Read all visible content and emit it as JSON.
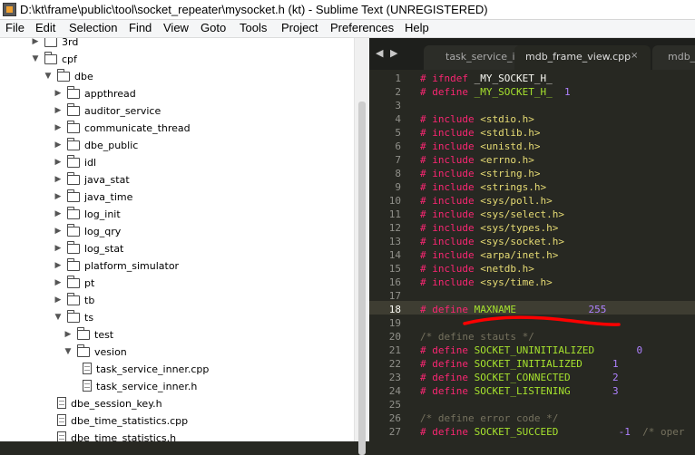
{
  "window": {
    "title": "D:\\kt\\frame\\public\\tool\\socket_repeater\\mysocket.h (kt) - Sublime Text (UNREGISTERED)"
  },
  "menu": [
    "File",
    "Edit",
    "Selection",
    "Find",
    "View",
    "Goto",
    "Tools",
    "Project",
    "Preferences",
    "Help"
  ],
  "sidebar": {
    "items": [
      {
        "label": "3rd",
        "type": "folder",
        "depth": 2,
        "expanded": false
      },
      {
        "label": "cpf",
        "type": "folder",
        "depth": 2,
        "expanded": true
      },
      {
        "label": "dbe",
        "type": "folder",
        "depth": 3,
        "expanded": true
      },
      {
        "label": "appthread",
        "type": "folder",
        "depth": 4,
        "expanded": false
      },
      {
        "label": "auditor_service",
        "type": "folder",
        "depth": 4,
        "expanded": false
      },
      {
        "label": "communicate_thread",
        "type": "folder",
        "depth": 4,
        "expanded": false
      },
      {
        "label": "dbe_public",
        "type": "folder",
        "depth": 4,
        "expanded": false
      },
      {
        "label": "idl",
        "type": "folder",
        "depth": 4,
        "expanded": false
      },
      {
        "label": "java_stat",
        "type": "folder",
        "depth": 4,
        "expanded": false
      },
      {
        "label": "java_time",
        "type": "folder",
        "depth": 4,
        "expanded": false
      },
      {
        "label": "log_init",
        "type": "folder",
        "depth": 4,
        "expanded": false
      },
      {
        "label": "log_qry",
        "type": "folder",
        "depth": 4,
        "expanded": false
      },
      {
        "label": "log_stat",
        "type": "folder",
        "depth": 4,
        "expanded": false
      },
      {
        "label": "platform_simulator",
        "type": "folder",
        "depth": 4,
        "expanded": false
      },
      {
        "label": "pt",
        "type": "folder",
        "depth": 4,
        "expanded": false
      },
      {
        "label": "tb",
        "type": "folder",
        "depth": 4,
        "expanded": false
      },
      {
        "label": "ts",
        "type": "folder",
        "depth": 4,
        "expanded": true
      },
      {
        "label": "test",
        "type": "folder",
        "depth": 5,
        "expanded": false
      },
      {
        "label": "vesion",
        "type": "folder",
        "depth": 5,
        "expanded": true
      },
      {
        "label": "task_service_inner.cpp",
        "type": "file",
        "depth": 6
      },
      {
        "label": "task_service_inner.h",
        "type": "file",
        "depth": 6
      },
      {
        "label": "dbe_session_key.h",
        "type": "file",
        "depth": 5
      },
      {
        "label": "dbe_time_statistics.cpp",
        "type": "file",
        "depth": 5
      },
      {
        "label": "dbe_time_statistics.h",
        "type": "file",
        "depth": 5
      }
    ]
  },
  "tabs": [
    {
      "label": "task_service_in",
      "active": false,
      "closable": false
    },
    {
      "label": "mdb_frame_view.cpp",
      "active": true,
      "closable": true,
      "close": "×"
    },
    {
      "label": "mdb_",
      "active": false,
      "closable": false
    }
  ],
  "tab_nav": {
    "left": "◀",
    "right": "▶"
  },
  "editor": {
    "current_line": 18,
    "lines": [
      {
        "n": "1",
        "t": [
          [
            "hash",
            "# "
          ],
          [
            "kw",
            "ifndef"
          ],
          [
            "ws",
            " _MY_SOCKET_H_"
          ]
        ]
      },
      {
        "n": "2",
        "t": [
          [
            "hash",
            "# "
          ],
          [
            "kw",
            "define"
          ],
          [
            "ws",
            " "
          ],
          [
            "mac",
            "_MY_SOCKET_H_"
          ],
          [
            "ws",
            "  "
          ],
          [
            "num",
            "1"
          ]
        ]
      },
      {
        "n": "3",
        "t": []
      },
      {
        "n": "4",
        "t": [
          [
            "hash",
            "# "
          ],
          [
            "kw",
            "include"
          ],
          [
            "ws",
            " "
          ],
          [
            "hdr",
            "<stdio.h>"
          ]
        ]
      },
      {
        "n": "5",
        "t": [
          [
            "hash",
            "# "
          ],
          [
            "kw",
            "include"
          ],
          [
            "ws",
            " "
          ],
          [
            "hdr",
            "<stdlib.h>"
          ]
        ]
      },
      {
        "n": "6",
        "t": [
          [
            "hash",
            "# "
          ],
          [
            "kw",
            "include"
          ],
          [
            "ws",
            " "
          ],
          [
            "hdr",
            "<unistd.h>"
          ]
        ]
      },
      {
        "n": "7",
        "t": [
          [
            "hash",
            "# "
          ],
          [
            "kw",
            "include"
          ],
          [
            "ws",
            " "
          ],
          [
            "hdr",
            "<errno.h>"
          ]
        ]
      },
      {
        "n": "8",
        "t": [
          [
            "hash",
            "# "
          ],
          [
            "kw",
            "include"
          ],
          [
            "ws",
            " "
          ],
          [
            "hdr",
            "<string.h>"
          ]
        ]
      },
      {
        "n": "9",
        "t": [
          [
            "hash",
            "# "
          ],
          [
            "kw",
            "include"
          ],
          [
            "ws",
            " "
          ],
          [
            "hdr",
            "<strings.h>"
          ]
        ]
      },
      {
        "n": "10",
        "t": [
          [
            "hash",
            "# "
          ],
          [
            "kw",
            "include"
          ],
          [
            "ws",
            " "
          ],
          [
            "hdr",
            "<sys/poll.h>"
          ]
        ]
      },
      {
        "n": "11",
        "t": [
          [
            "hash",
            "# "
          ],
          [
            "kw",
            "include"
          ],
          [
            "ws",
            " "
          ],
          [
            "hdr",
            "<sys/select.h>"
          ]
        ]
      },
      {
        "n": "12",
        "t": [
          [
            "hash",
            "# "
          ],
          [
            "kw",
            "include"
          ],
          [
            "ws",
            " "
          ],
          [
            "hdr",
            "<sys/types.h>"
          ]
        ]
      },
      {
        "n": "13",
        "t": [
          [
            "hash",
            "# "
          ],
          [
            "kw",
            "include"
          ],
          [
            "ws",
            " "
          ],
          [
            "hdr",
            "<sys/socket.h>"
          ]
        ]
      },
      {
        "n": "14",
        "t": [
          [
            "hash",
            "# "
          ],
          [
            "kw",
            "include"
          ],
          [
            "ws",
            " "
          ],
          [
            "hdr",
            "<arpa/inet.h>"
          ]
        ]
      },
      {
        "n": "15",
        "t": [
          [
            "hash",
            "# "
          ],
          [
            "kw",
            "include"
          ],
          [
            "ws",
            " "
          ],
          [
            "hdr",
            "<netdb.h>"
          ]
        ]
      },
      {
        "n": "16",
        "t": [
          [
            "hash",
            "# "
          ],
          [
            "kw",
            "include"
          ],
          [
            "ws",
            " "
          ],
          [
            "hdr",
            "<sys/time.h>"
          ]
        ]
      },
      {
        "n": "17",
        "t": []
      },
      {
        "n": "18",
        "t": [
          [
            "hash",
            "# "
          ],
          [
            "kw",
            "define"
          ],
          [
            "ws",
            " "
          ],
          [
            "mac",
            "MAXNAME"
          ],
          [
            "ws",
            "            "
          ],
          [
            "num",
            "255"
          ]
        ]
      },
      {
        "n": "19",
        "t": []
      },
      {
        "n": "20",
        "t": [
          [
            "cmt",
            "/* define stauts */"
          ]
        ]
      },
      {
        "n": "21",
        "t": [
          [
            "hash",
            "# "
          ],
          [
            "kw",
            "define"
          ],
          [
            "ws",
            " "
          ],
          [
            "mac",
            "SOCKET_UNINITIALIZED"
          ],
          [
            "ws",
            "       "
          ],
          [
            "num",
            "0"
          ]
        ]
      },
      {
        "n": "22",
        "t": [
          [
            "hash",
            "# "
          ],
          [
            "kw",
            "define"
          ],
          [
            "ws",
            " "
          ],
          [
            "mac",
            "SOCKET_INITIALIZED"
          ],
          [
            "ws",
            "     "
          ],
          [
            "num",
            "1"
          ]
        ]
      },
      {
        "n": "23",
        "t": [
          [
            "hash",
            "# "
          ],
          [
            "kw",
            "define"
          ],
          [
            "ws",
            " "
          ],
          [
            "mac",
            "SOCKET_CONNECTED"
          ],
          [
            "ws",
            "       "
          ],
          [
            "num",
            "2"
          ]
        ]
      },
      {
        "n": "24",
        "t": [
          [
            "hash",
            "# "
          ],
          [
            "kw",
            "define"
          ],
          [
            "ws",
            " "
          ],
          [
            "mac",
            "SOCKET_LISTENING"
          ],
          [
            "ws",
            "       "
          ],
          [
            "num",
            "3"
          ]
        ]
      },
      {
        "n": "25",
        "t": []
      },
      {
        "n": "26",
        "t": [
          [
            "cmt",
            "/* define error code */"
          ]
        ]
      },
      {
        "n": "27",
        "t": [
          [
            "hash",
            "# "
          ],
          [
            "kw",
            "define"
          ],
          [
            "ws",
            " "
          ],
          [
            "mac",
            "SOCKET_SUCCEED"
          ],
          [
            "ws",
            "          "
          ],
          [
            "num",
            "-1"
          ],
          [
            "ws",
            "  "
          ],
          [
            "cmt",
            "/* oper"
          ]
        ]
      }
    ]
  },
  "colors": {
    "editor_bg": "#272822",
    "keyword": "#f92672",
    "macro": "#a6e22e",
    "string": "#e6db74",
    "number": "#ae81ff",
    "comment": "#75715e",
    "annotation": "#ff0000"
  }
}
